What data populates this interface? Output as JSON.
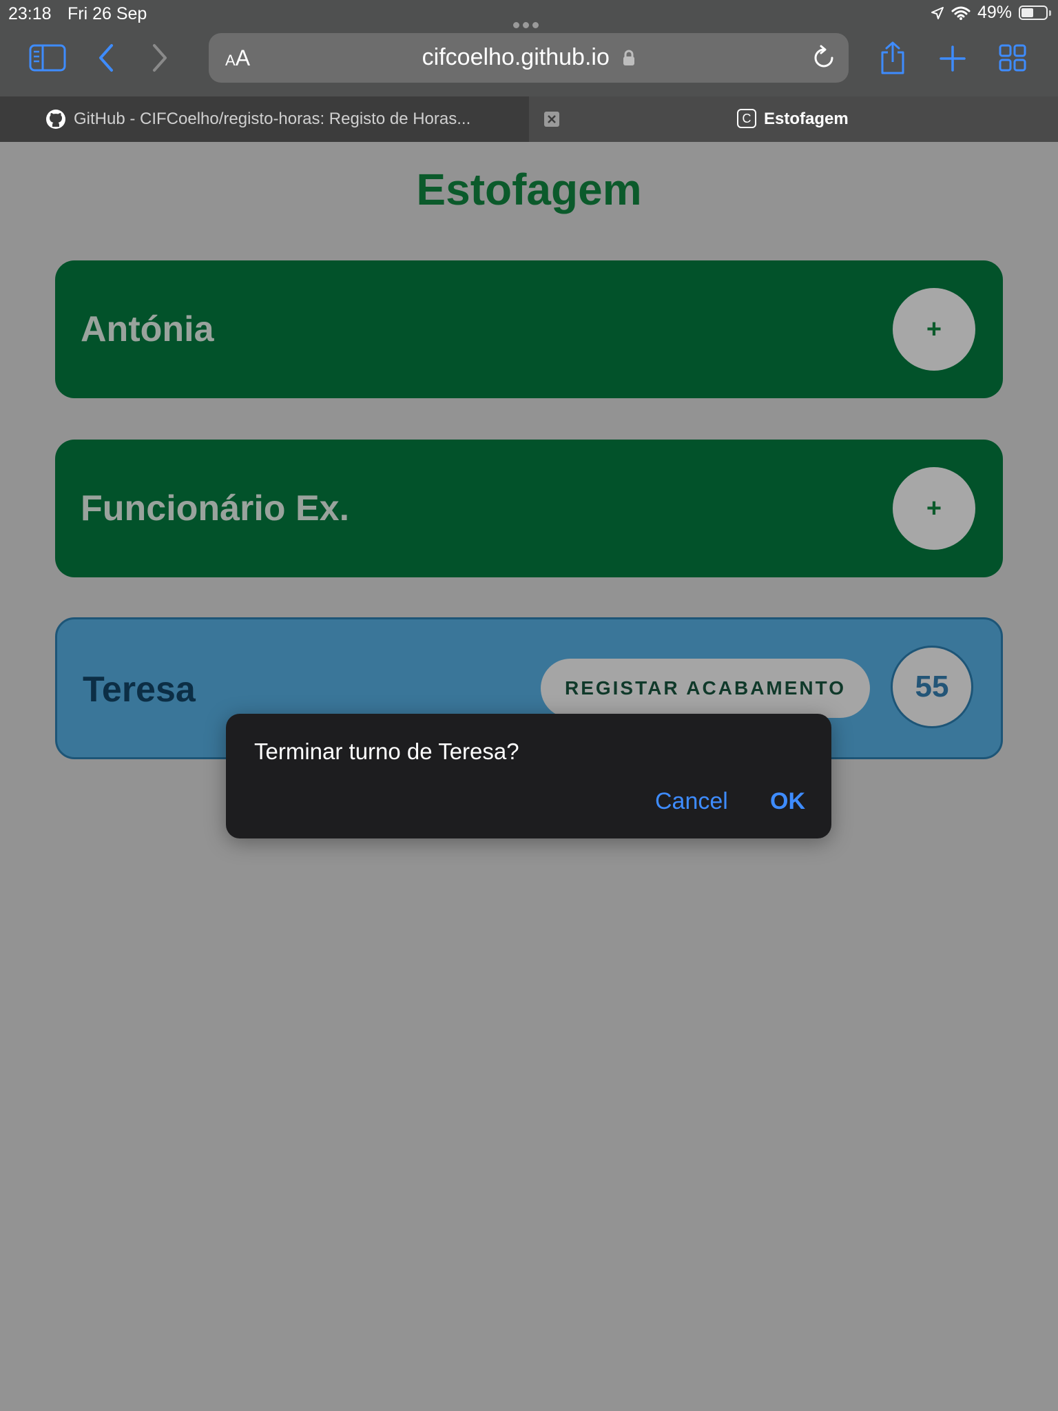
{
  "status_bar": {
    "time": "23:18",
    "date": "Fri 26 Sep",
    "battery": "49%",
    "battery_level": 0.49
  },
  "browser": {
    "aa_small": "A",
    "aa_large": "A",
    "url": "cifcoelho.github.io",
    "tabs": [
      {
        "label": "GitHub - CIFCoelho/registo-horas: Registo de Horas..."
      },
      {
        "label": "Estofagem",
        "favicon": "C"
      }
    ],
    "accent": "#3e8cff"
  },
  "page": {
    "title": "Estofagem",
    "cards": [
      {
        "name": "Antónia",
        "action": "+"
      },
      {
        "name": "Funcionário Ex.",
        "action": "+"
      },
      {
        "name": "Teresa",
        "action_label": "REGISTAR ACABAMENTO",
        "count": "55"
      }
    ]
  },
  "dialog": {
    "message": "Terminar turno de Teresa?",
    "cancel_label": "Cancel",
    "ok_label": "OK"
  }
}
